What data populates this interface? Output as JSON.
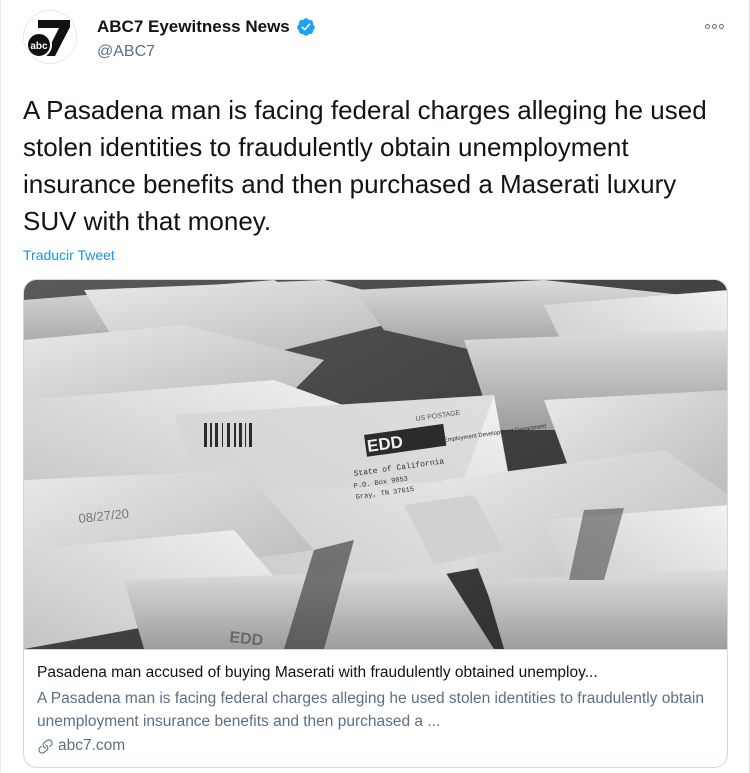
{
  "author": {
    "display_name": "ABC7 Eyewitness News",
    "handle": "@ABC7",
    "avatar_logo": "abc",
    "avatar_number": "7",
    "verified": true
  },
  "tweet": {
    "text": "A Pasadena man is facing federal charges alleging he used stolen identities to fraudulently obtain unemployment insurance benefits and then purchased a Maserati luxury SUV with that money.",
    "translate_label": "Traducir Tweet"
  },
  "card": {
    "title": "Pasadena man accused of buying Maserati with fraudulently obtained unemploy...",
    "description": "A Pasadena man is facing federal charges alleging he used stolen identities to fraudulently obtain unemployment insurance benefits and then purchased a ...",
    "domain": "abc7.com",
    "image": {
      "envelope_edd_label": "EDD",
      "envelope_org_label": "Employment Development Department",
      "envelope_state_label": "State of California",
      "envelope_box_label": "P.O. Box 9053",
      "envelope_city_label": "Gray, TN 37615",
      "envelope_postage_label": "US POSTAGE",
      "envelope_date_label": "08/27/20",
      "envelope_edd_label_2": "EDD"
    }
  },
  "colors": {
    "link_blue": "#1b95e0",
    "verified_blue": "#1da1f2",
    "secondary_text": "#5b7083",
    "abc_black": "#111111"
  },
  "icons": {
    "more": "more-horizontal-icon",
    "verified": "verified-badge-icon",
    "link": "link-icon"
  }
}
